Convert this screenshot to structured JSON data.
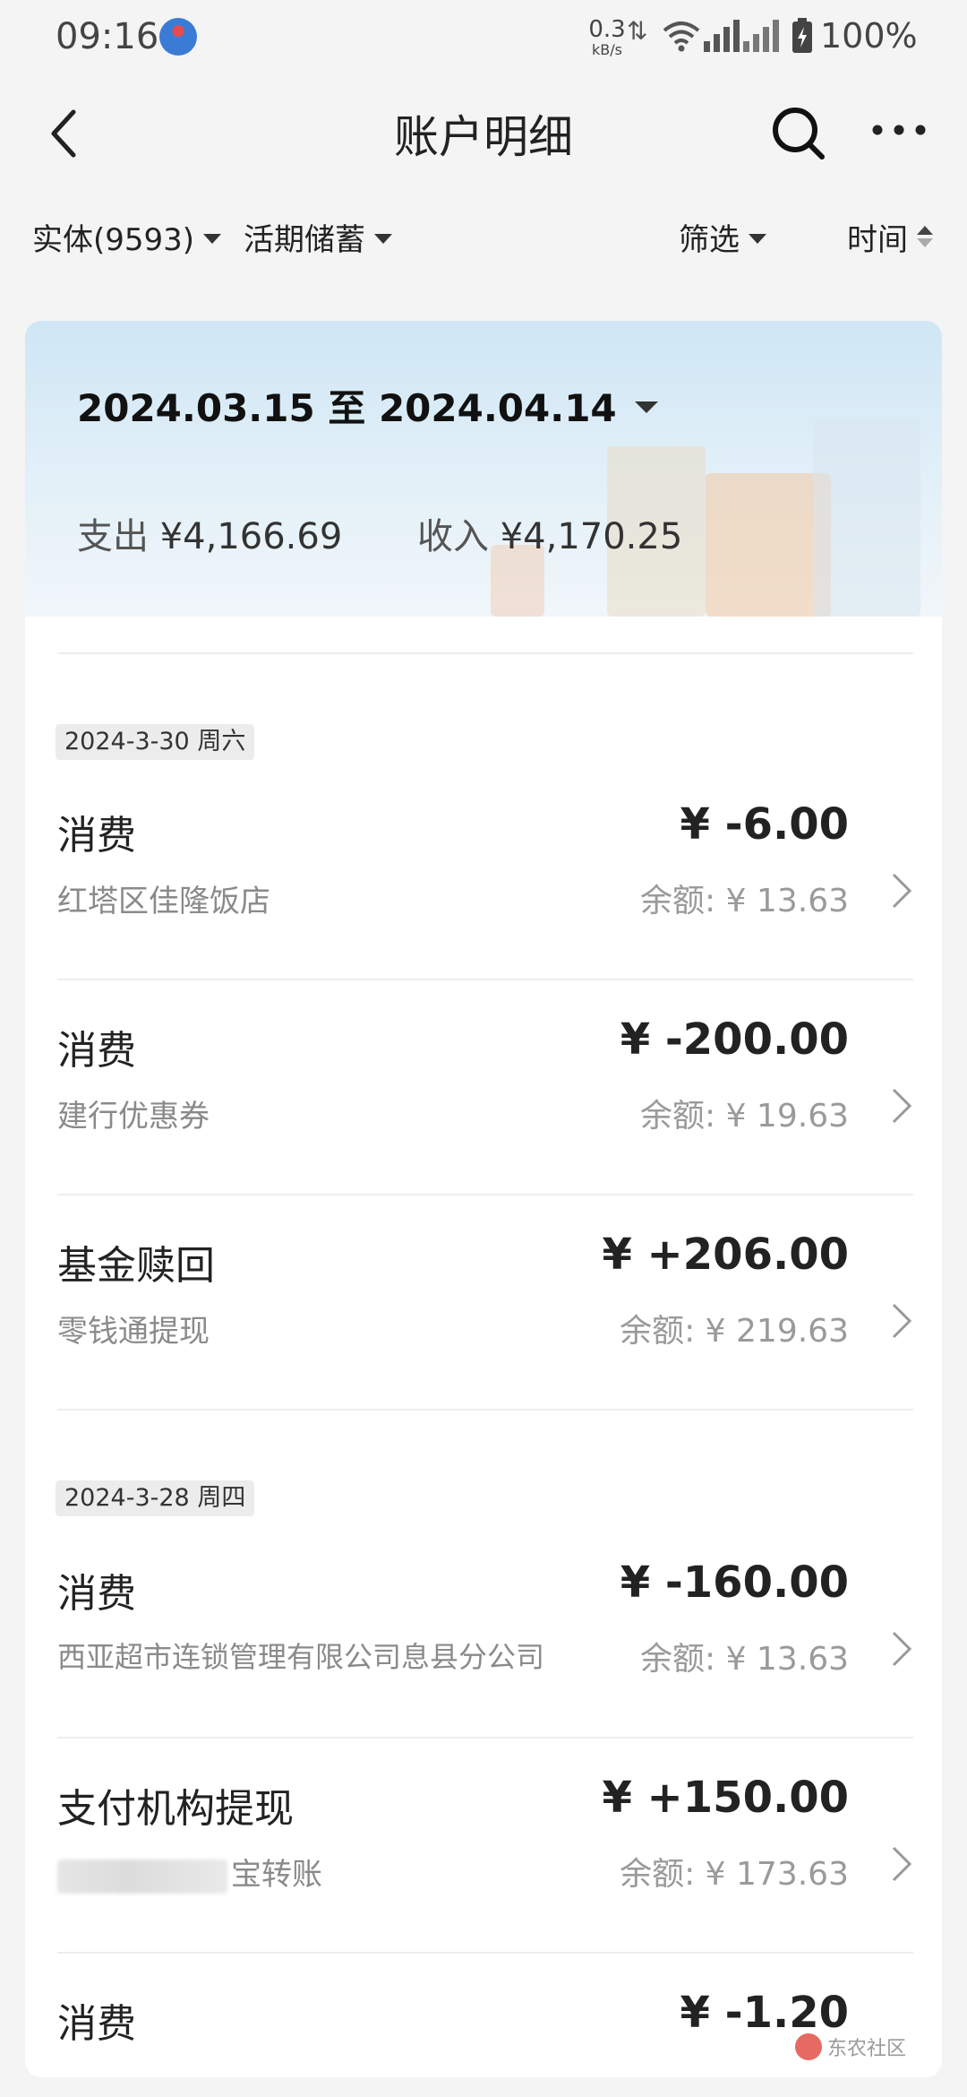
{
  "status_bar": {
    "time": "09:16",
    "net_speed": "0.3",
    "net_unit": "kB/s",
    "battery": "100%"
  },
  "nav": {
    "title": "账户明细"
  },
  "filters": {
    "account": "实体(9593)",
    "type": "活期储蓄",
    "filter": "筛选",
    "time": "时间"
  },
  "summary": {
    "date_range": "2024.03.15 至 2024.04.14",
    "expense_label": "支出",
    "expense": "¥4,166.69",
    "income_label": "收入",
    "income": "¥4,170.25"
  },
  "groups": [
    {
      "date": "2024-3-30 周六",
      "items": [
        {
          "title": "消费",
          "amount": "¥ -6.00",
          "desc": "红塔区佳隆饭店",
          "balance": "余额: ¥ 13.63"
        },
        {
          "title": "消费",
          "amount": "¥ -200.00",
          "desc": "建行优惠券",
          "balance": "余额: ¥ 19.63"
        },
        {
          "title": "基金赎回",
          "amount": "¥ +206.00",
          "desc": "零钱通提现",
          "balance": "余额: ¥ 219.63"
        }
      ]
    },
    {
      "date": "2024-3-28 周四",
      "items": [
        {
          "title": "消费",
          "amount": "¥ -160.00",
          "desc": "西亚超市连锁管理有限公司息县分公司",
          "balance": "余额: ¥ 13.63"
        },
        {
          "title": "支付机构提现",
          "amount": "¥ +150.00",
          "desc": "宝转账",
          "balance": "余额: ¥ 173.63"
        },
        {
          "title": "消费",
          "amount": "¥ -1.20"
        }
      ]
    }
  ],
  "watermark": "东农社区"
}
